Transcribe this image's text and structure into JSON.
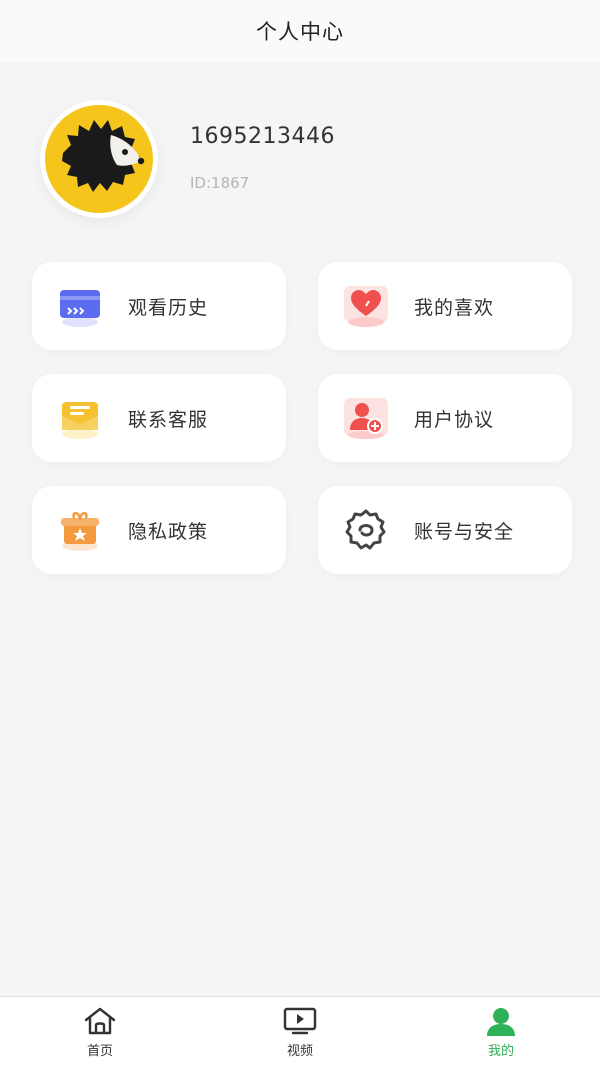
{
  "header": {
    "title": "个人中心"
  },
  "profile": {
    "avatar_icon": "hedgehog-avatar-icon",
    "username": "1695213446",
    "user_id": "ID:1867"
  },
  "menu": {
    "items": [
      {
        "label": "观看历史",
        "icon": "history-icon",
        "color": "#5b6cf0"
      },
      {
        "label": "我的喜欢",
        "icon": "heart-icon",
        "color": "#f0514f"
      },
      {
        "label": "联系客服",
        "icon": "mail-icon",
        "color": "#f5c130"
      },
      {
        "label": "用户协议",
        "icon": "user-agreement-icon",
        "color": "#f0514f"
      },
      {
        "label": "隐私政策",
        "icon": "gift-box-icon",
        "color": "#f39a3e"
      },
      {
        "label": "账号与安全",
        "icon": "gear-icon",
        "color": "#444444"
      }
    ]
  },
  "tabbar": {
    "tabs": [
      {
        "label": "首页",
        "icon": "home-icon"
      },
      {
        "label": "视频",
        "icon": "tv-icon"
      },
      {
        "label": "我的",
        "icon": "user-icon",
        "active": true
      }
    ],
    "active_color": "#2fb157"
  }
}
